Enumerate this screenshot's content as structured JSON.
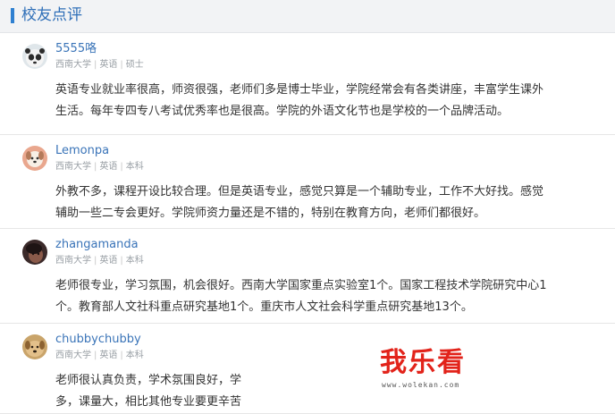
{
  "header": {
    "title": "校友点评"
  },
  "comments": [
    {
      "username": "5555咯",
      "school": "西南大学",
      "major": "英语",
      "degree": "硕士",
      "avatar": "panda-avatar",
      "lines": [
        "英语专业就业率很高，师资很强，老师们多是博士毕业，学院经常会有各类讲座，丰富学生课外",
        "生活。每年专四专八考试优秀率也是很高。学院的外语文化节也是学校的一个品牌活动。"
      ]
    },
    {
      "username": "Lemonpa",
      "school": "西南大学",
      "major": "英语",
      "degree": "本科",
      "avatar": "puppy-avatar",
      "lines": [
        "外教不多，课程开设比较合理。但是英语专业，感觉只算是一个辅助专业，工作不大好找。感觉",
        "辅助一些二专会更好。学院师资力量还是不错的，特别在教育方向，老师们都很好。"
      ]
    },
    {
      "username": "zhangamanda",
      "school": "西南大学",
      "major": "英语",
      "degree": "本科",
      "avatar": "dark-photo-avatar",
      "lines": [
        "老师很专业，学习氛围，机会很好。西南大学国家重点实验室1个。国家工程技术学院研究中心1",
        "个。教育部人文社科重点研究基地1个。重庆市人文社会科学重点研究基地13个。"
      ]
    },
    {
      "username": "chubbychubby",
      "school": "西南大学",
      "major": "英语",
      "degree": "本科",
      "avatar": "dog-avatar",
      "lines": [
        "老师很认真负责，学术氛围良好，学",
        "多，课量大，相比其他专业要更辛苦"
      ]
    }
  ],
  "watermark": {
    "text": "我乐看",
    "url": "www.wolekan.com",
    "color": "#e2231a"
  }
}
